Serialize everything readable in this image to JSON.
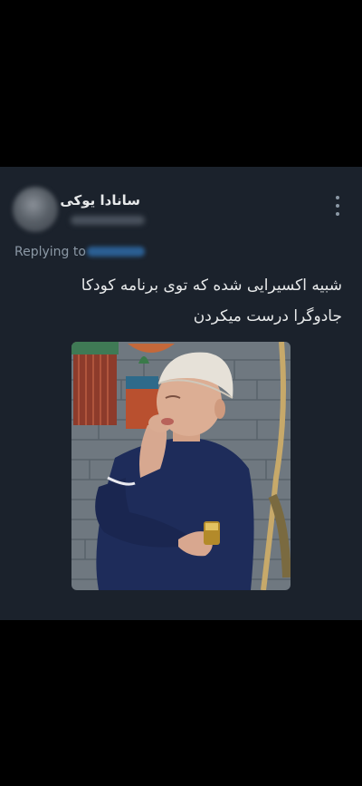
{
  "tweet": {
    "display_name": "سانادا یوکی",
    "replying_label": "Replying to",
    "text_lines": [
      "شبیه اکسیرایی شده که توی برنامه کودکا",
      "جادوگرا درست میکردن"
    ],
    "media_icon": "photo-man-in-cap"
  },
  "colors": {
    "background": "#000000",
    "card": "#1b222c",
    "primary_text": "#e7e9ea",
    "secondary_text": "#8b98a5",
    "link": "#1d9bf0"
  },
  "icons": {
    "more": "more-vertical-icon",
    "avatar": "avatar-blurred"
  }
}
